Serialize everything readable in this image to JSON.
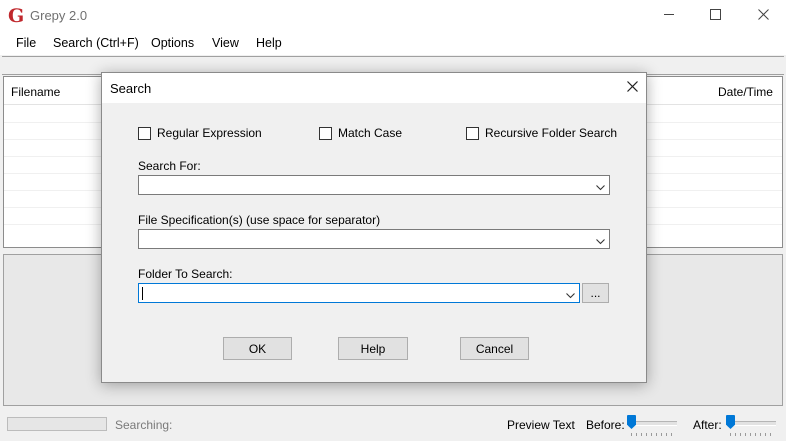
{
  "window": {
    "icon_glyph": "G",
    "title": "Grepy 2.0",
    "controls": {
      "minimize": "minimize-icon",
      "maximize": "maximize-icon",
      "close": "close-icon"
    }
  },
  "menu": [
    {
      "label": "File"
    },
    {
      "label": "Search (Ctrl+F)"
    },
    {
      "label": "Options"
    },
    {
      "label": "View"
    },
    {
      "label": "Help"
    }
  ],
  "results": {
    "columns": {
      "filename": "Filename",
      "datetime": "Date/Time"
    }
  },
  "statusbar": {
    "searching": "Searching:",
    "preview_text": "Preview Text",
    "before_label": "Before:",
    "after_label": "After:",
    "before_value": 0,
    "after_value": 0
  },
  "dialog": {
    "title": "Search",
    "checkboxes": {
      "regex": {
        "label": "Regular Expression",
        "checked": false
      },
      "match_case": {
        "label": "Match Case",
        "checked": false
      },
      "recursive": {
        "label": "Recursive Folder Search",
        "checked": false
      }
    },
    "search_for": {
      "label": "Search For:",
      "value": ""
    },
    "file_spec": {
      "label": "File Specification(s) (use space for separator)",
      "value": ""
    },
    "folder": {
      "label": "Folder To Search:",
      "value": "",
      "browse_label": "..."
    },
    "buttons": {
      "ok": "OK",
      "help": "Help",
      "cancel": "Cancel"
    }
  },
  "colors": {
    "accent": "#0078d7",
    "app_icon": "#c0282d"
  }
}
